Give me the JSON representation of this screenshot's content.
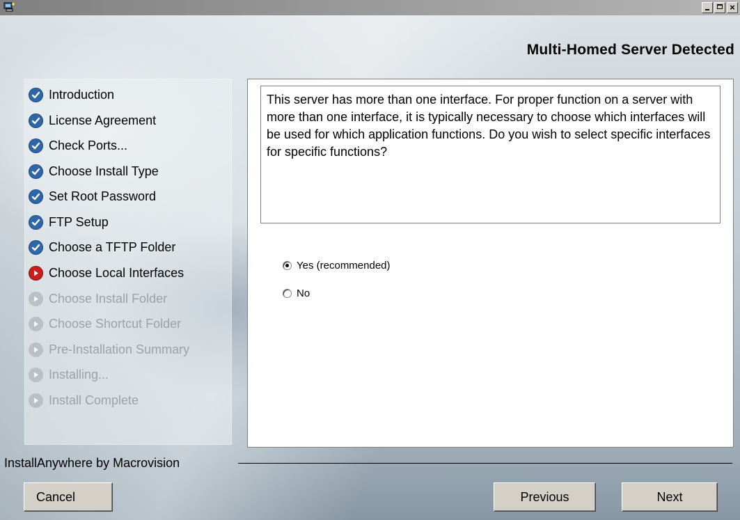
{
  "window": {
    "title": "",
    "controls": {
      "minimize_icon": "minimize-icon",
      "maximize_icon": "maximize-icon",
      "close_label": "×"
    }
  },
  "header": {
    "title": "Multi-Homed Server Detected"
  },
  "steps": [
    {
      "label": "Introduction",
      "state": "done"
    },
    {
      "label": "License Agreement",
      "state": "done"
    },
    {
      "label": "Check Ports...",
      "state": "done"
    },
    {
      "label": "Choose Install Type",
      "state": "done"
    },
    {
      "label": "Set Root Password",
      "state": "done"
    },
    {
      "label": "FTP Setup",
      "state": "done"
    },
    {
      "label": "Choose a TFTP Folder",
      "state": "done"
    },
    {
      "label": "Choose Local Interfaces",
      "state": "current"
    },
    {
      "label": "Choose Install Folder",
      "state": "pending"
    },
    {
      "label": "Choose Shortcut Folder",
      "state": "pending"
    },
    {
      "label": "Pre-Installation Summary",
      "state": "pending"
    },
    {
      "label": "Installing...",
      "state": "pending"
    },
    {
      "label": "Install Complete",
      "state": "pending"
    }
  ],
  "main": {
    "description": "This server has more than one interface.  For proper function on a server with more than one interface, it is typically necessary to choose which interfaces will be used for which application functions.  Do you wish to select specific interfaces for specific functions?",
    "options": [
      {
        "label": "Yes (recommended)",
        "selected": true
      },
      {
        "label": "No",
        "selected": false
      }
    ]
  },
  "footer": {
    "brand": "InstallAnywhere by Macrovision",
    "cancel_label": "Cancel",
    "previous_label": "Previous",
    "next_label": "Next"
  },
  "colors": {
    "done_icon": "#2f66a8",
    "current_icon": "#c8201e",
    "pending_icon": "#b9c0c6",
    "pending_text": "#9aa3aa"
  }
}
